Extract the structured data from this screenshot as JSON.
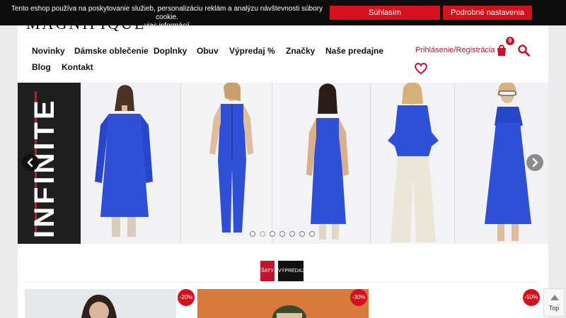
{
  "cookie": {
    "text": "Tento eshop používa na poskytovanie služieb, personalizáciu reklám a analýzu návštevnosti súbory cookie.",
    "more_link": "viac informácií",
    "accept_label": "Súhlasím",
    "settings_label": "Podrobné nastavenia"
  },
  "header": {
    "logo": "MAGNIFIQUE",
    "nav": [
      "Novinky",
      "Dámske oblečenie",
      "Doplnky",
      "Obuv",
      "Výpredaj %",
      "Značky",
      "Naše predajne",
      "Blog",
      "Kontakt"
    ],
    "login_label": "Prihlásenie/Registrácia",
    "cart_count": "0"
  },
  "slider": {
    "brand": "INFINITE",
    "slide_count": 7,
    "active_slide": 2
  },
  "tags": [
    "ŠATY",
    "VÝPREDAJ"
  ],
  "products": [
    {
      "discount": "-20%"
    },
    {
      "discount": "-30%"
    },
    {
      "discount": "-50%"
    }
  ],
  "to_top_label": "Top",
  "colors": {
    "accent_red": "#d6111e",
    "dress_blue": "#2f4fd6",
    "cookie_bar": "#0d0d0d"
  }
}
